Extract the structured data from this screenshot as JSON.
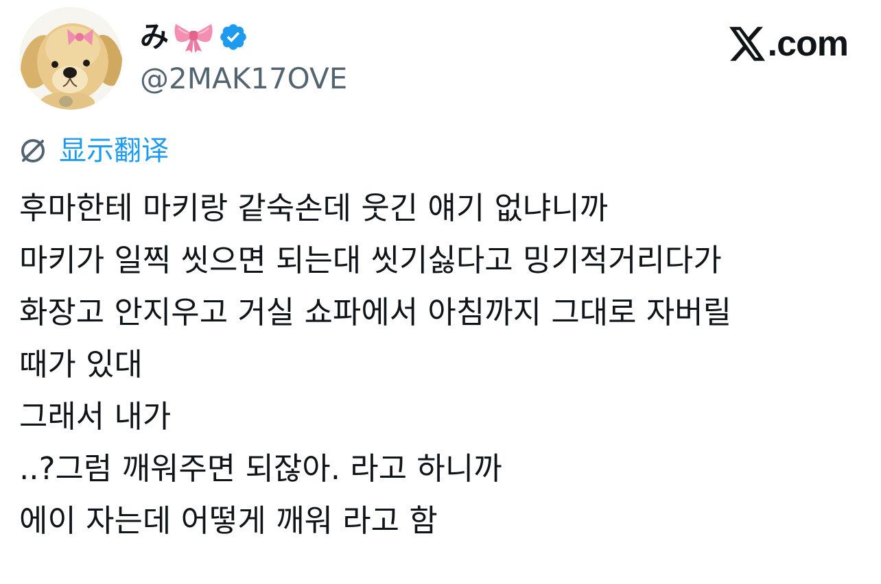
{
  "author": {
    "display_name": "み",
    "name_emoji": "bow-emoji",
    "verified": true,
    "handle": "@2MAK17OVE",
    "avatar": "plush-puppy-with-pink-bow"
  },
  "brand": {
    "icon": "x-logo-icon",
    "domain_text": ".com"
  },
  "translate": {
    "icon": "globe-icon",
    "label": "显示翻译"
  },
  "tweet": {
    "lines": [
      "후마한테 마키랑 같숙손데 웃긴 얘기 없냐니까",
      "마키가 일찍 씻으면 되는대 씻기싫다고 밍기적거리다가",
      "화장고 안지우고 거실 쇼파에서 아침까지 그대로 자버릴",
      "때가 있대",
      "그래서 내가",
      "..?그럼 깨워주면 되잖아. 라고 하니까",
      "에이 자는데 어떻게 깨워 라고 함"
    ]
  },
  "colors": {
    "text": "#0f1419",
    "secondary": "#536471",
    "link": "#1d9bf0",
    "verified": "#1d9bf0",
    "bow": "#f48fb1"
  }
}
